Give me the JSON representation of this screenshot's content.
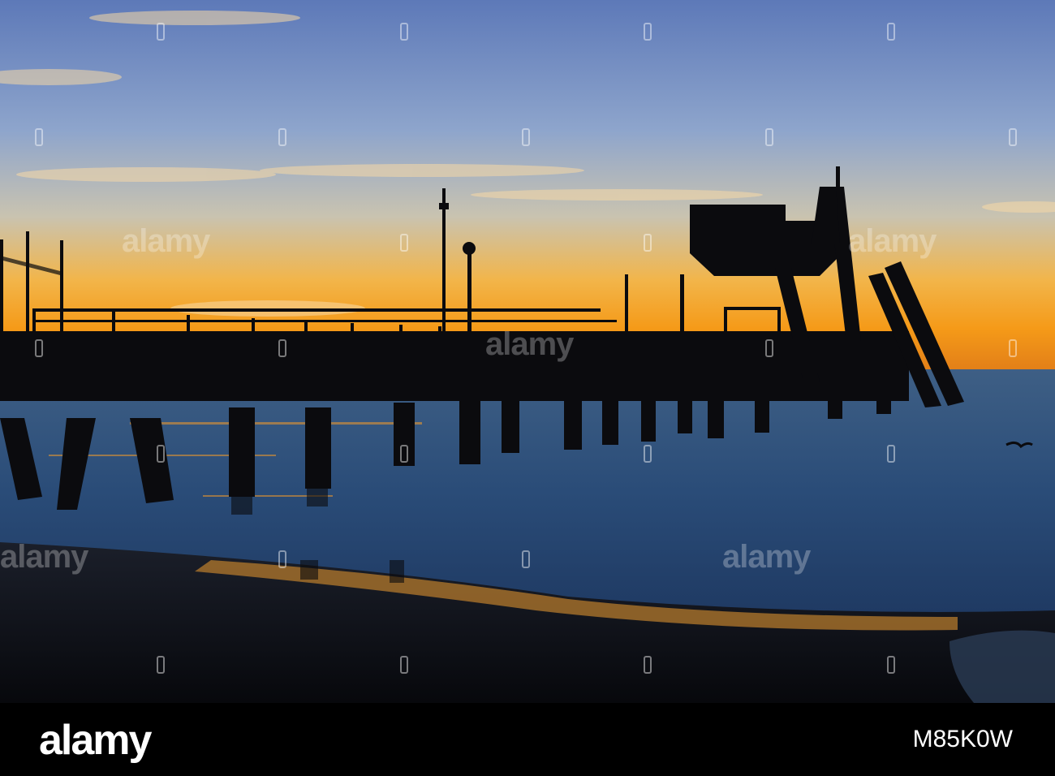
{
  "watermark": {
    "text": "alamy"
  },
  "footer": {
    "logo": "alamy",
    "image_id": "M85K0W"
  },
  "colors": {
    "sky_top": "#5d79b8",
    "sky_mid": "#a3b6d0",
    "horizon_glow": "#f6a11a",
    "water": "#2c4f7a",
    "sand": "#0e1118",
    "silhouette": "#0a0a0c"
  }
}
